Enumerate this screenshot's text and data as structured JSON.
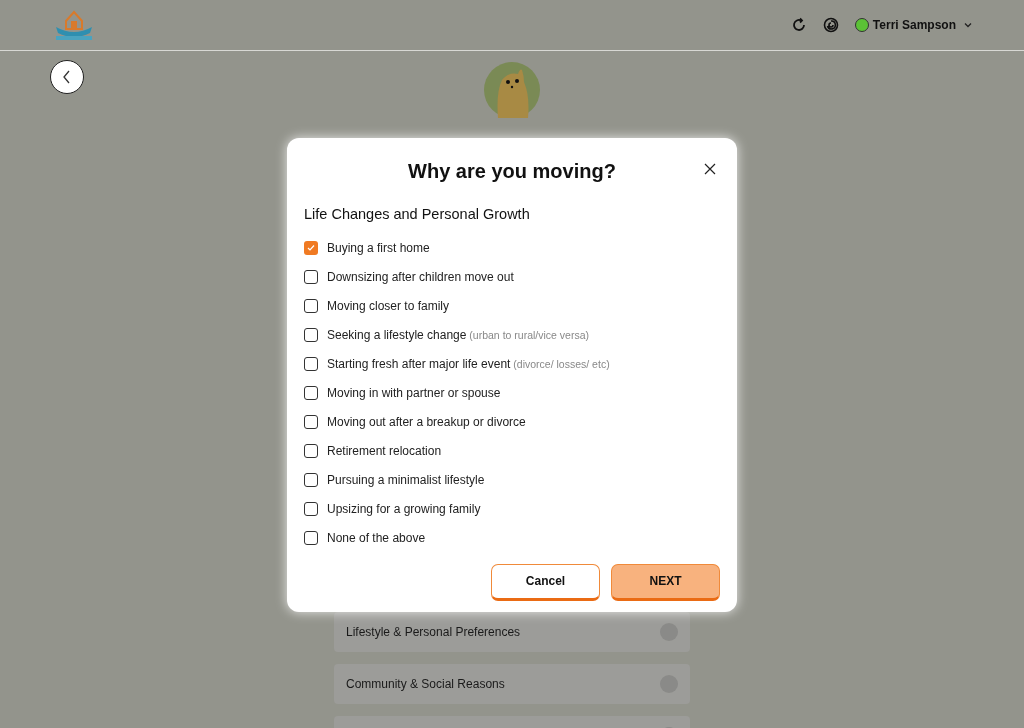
{
  "header": {
    "user_name": "Terri Sampson"
  },
  "background_cards": [
    {
      "label": "Lifestyle & Personal Preferences"
    },
    {
      "label": "Community & Social Reasons"
    }
  ],
  "modal": {
    "title": "Why are you moving?",
    "section": "Life Changes and Personal Growth",
    "options": [
      {
        "label": "Buying a first home",
        "checked": true
      },
      {
        "label": "Downsizing after children move out",
        "checked": false
      },
      {
        "label": "Moving closer to family",
        "checked": false
      },
      {
        "label": "Seeking a lifestyle change",
        "note": "(urban to rural/vice versa)",
        "checked": false
      },
      {
        "label": "Starting fresh after major life event",
        "note": "(divorce/ losses/ etc)",
        "checked": false
      },
      {
        "label": "Moving in with partner or spouse",
        "checked": false
      },
      {
        "label": "Moving out after a breakup or divorce",
        "checked": false
      },
      {
        "label": "Retirement relocation",
        "checked": false
      },
      {
        "label": "Pursuing a minimalist lifestyle",
        "checked": false
      },
      {
        "label": "Upsizing for a growing family",
        "checked": false
      },
      {
        "label": "None of the above",
        "checked": false
      }
    ],
    "buttons": [
      {
        "label": "Cancel",
        "kind": "secondary"
      },
      {
        "label": "NEXT",
        "kind": "primary"
      }
    ]
  }
}
